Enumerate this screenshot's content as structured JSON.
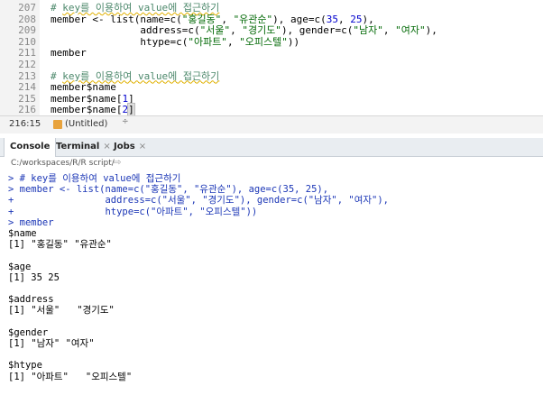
{
  "editor": {
    "lines": [
      {
        "num": "207",
        "segments": [
          {
            "t": "# ",
            "c": "cmt"
          },
          {
            "t": "key를 이용하여 value에 접근하기",
            "c": "cmt wavy"
          }
        ]
      },
      {
        "num": "208",
        "segments": [
          {
            "t": "member <- list(name=c(",
            "c": ""
          },
          {
            "t": "\"홍길동\"",
            "c": "str"
          },
          {
            "t": ", ",
            "c": ""
          },
          {
            "t": "\"유관순\"",
            "c": "str"
          },
          {
            "t": "), age=c(",
            "c": ""
          },
          {
            "t": "35",
            "c": "num2"
          },
          {
            "t": ", ",
            "c": ""
          },
          {
            "t": "25",
            "c": "num2"
          },
          {
            "t": "),",
            "c": ""
          }
        ]
      },
      {
        "num": "209",
        "segments": [
          {
            "t": "               address=c(",
            "c": ""
          },
          {
            "t": "\"서울\"",
            "c": "str"
          },
          {
            "t": ", ",
            "c": ""
          },
          {
            "t": "\"경기도\"",
            "c": "str"
          },
          {
            "t": "), gender=c(",
            "c": ""
          },
          {
            "t": "\"남자\"",
            "c": "str"
          },
          {
            "t": ", ",
            "c": ""
          },
          {
            "t": "\"여자\"",
            "c": "str"
          },
          {
            "t": "),",
            "c": ""
          }
        ]
      },
      {
        "num": "210",
        "segments": [
          {
            "t": "               htype=c(",
            "c": ""
          },
          {
            "t": "\"아파트\"",
            "c": "str"
          },
          {
            "t": ", ",
            "c": ""
          },
          {
            "t": "\"오피스텔\"",
            "c": "str"
          },
          {
            "t": "))",
            "c": ""
          }
        ]
      },
      {
        "num": "211",
        "segments": [
          {
            "t": "member",
            "c": ""
          }
        ]
      },
      {
        "num": "212",
        "segments": []
      },
      {
        "num": "213",
        "segments": [
          {
            "t": "# ",
            "c": "cmt"
          },
          {
            "t": "key를 이용하여 value에 접근하기",
            "c": "cmt wavy"
          }
        ]
      },
      {
        "num": "214",
        "segments": [
          {
            "t": "member$name",
            "c": ""
          }
        ]
      },
      {
        "num": "215",
        "segments": [
          {
            "t": "member$name[",
            "c": ""
          },
          {
            "t": "1",
            "c": "num2"
          },
          {
            "t": "]",
            "c": ""
          }
        ]
      },
      {
        "num": "216",
        "segments": [
          {
            "t": "member$name[",
            "c": ""
          },
          {
            "t": "2",
            "c": "num2"
          },
          {
            "t": "]",
            "c": "hl"
          },
          {
            "t": "",
            "c": "cursor"
          }
        ]
      }
    ]
  },
  "statusbar": {
    "position": "216:15",
    "scope": "(Untitled)",
    "scope_chevron": "÷"
  },
  "tabs": [
    {
      "label": "Console",
      "close": ""
    },
    {
      "label": "Terminal",
      "close": "×"
    },
    {
      "label": "Jobs",
      "close": "×"
    }
  ],
  "console": {
    "path": "C:/workspaces/R/R script/",
    "path_icon": "arrow-icon",
    "lines": [
      {
        "t": "> # key를 이용하여 value에 접근하기",
        "k": "in"
      },
      {
        "t": "> member <- list(name=c(\"홍길동\", \"유관순\"), age=c(35, 25),",
        "k": "in"
      },
      {
        "t": "+                address=c(\"서울\", \"경기도\"), gender=c(\"남자\", \"여자\"),",
        "k": "in"
      },
      {
        "t": "+                htype=c(\"아파트\", \"오피스텔\"))",
        "k": "in"
      },
      {
        "t": "> member",
        "k": "in"
      },
      {
        "t": "$name",
        "k": "out"
      },
      {
        "t": "[1] \"홍길동\" \"유관순\"",
        "k": "out"
      },
      {
        "t": "",
        "k": "out"
      },
      {
        "t": "$age",
        "k": "out"
      },
      {
        "t": "[1] 35 25",
        "k": "out"
      },
      {
        "t": "",
        "k": "out"
      },
      {
        "t": "$address",
        "k": "out"
      },
      {
        "t": "[1] \"서울\"   \"경기도\"",
        "k": "out"
      },
      {
        "t": "",
        "k": "out"
      },
      {
        "t": "$gender",
        "k": "out"
      },
      {
        "t": "[1] \"남자\" \"여자\"",
        "k": "out"
      },
      {
        "t": "",
        "k": "out"
      },
      {
        "t": "$htype",
        "k": "out"
      },
      {
        "t": "[1] \"아파트\"   \"오피스텔\"",
        "k": "out"
      }
    ]
  },
  "colors": {
    "comment": "#4c886b",
    "string": "#036a07",
    "number": "#0000cd",
    "console_input": "#1b36b6",
    "console_output": "#000000"
  }
}
